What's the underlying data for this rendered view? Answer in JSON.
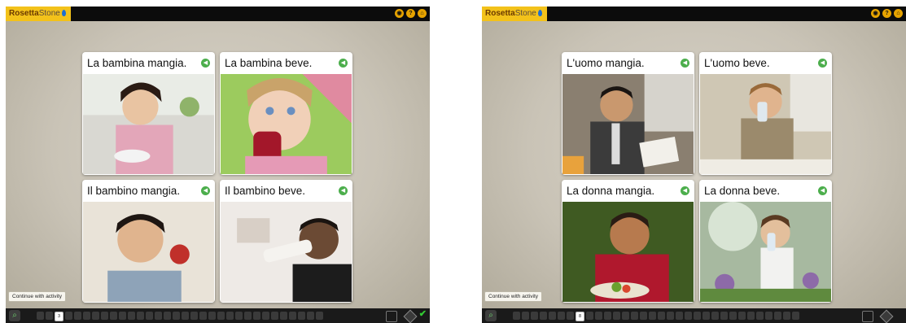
{
  "app": {
    "logo_brand": "Rosetta",
    "logo_suffix": "Stone"
  },
  "tooltip": "Continue with activity",
  "left_screen": {
    "cards": [
      {
        "caption": "La bambina mangia."
      },
      {
        "caption": "La bambina beve."
      },
      {
        "caption": "Il bambino mangia."
      },
      {
        "caption": "Il bambino beve."
      }
    ],
    "current_step": "3"
  },
  "right_screen": {
    "cards": [
      {
        "caption": "L'uomo mangia."
      },
      {
        "caption": "L'uomo beve."
      },
      {
        "caption": "La donna mangia."
      },
      {
        "caption": "La donna beve."
      }
    ],
    "current_step": "8"
  },
  "icons": {
    "audio": "speaker-icon",
    "top": [
      "voice-icon",
      "help-icon",
      "home-icon"
    ],
    "bottom": [
      "magnifier-icon",
      "diamond-nav-icon",
      "check-icon"
    ]
  },
  "colors": {
    "logo_bg": "#f3c21a",
    "audio_green": "#4cae4c",
    "top_bar": "#0c0c0c"
  }
}
